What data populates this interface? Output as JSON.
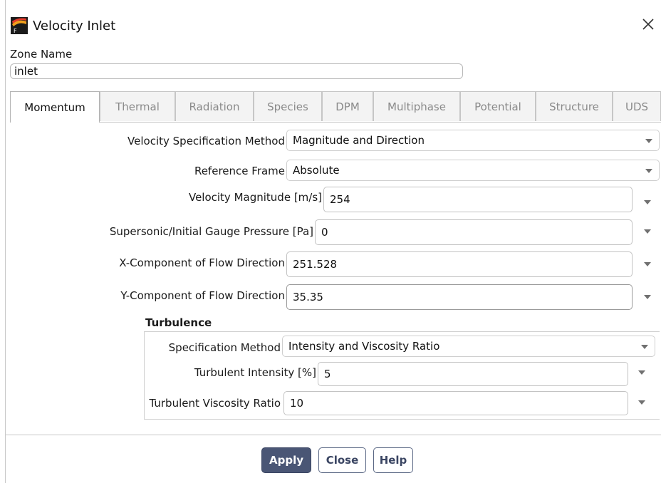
{
  "window": {
    "title": "Velocity Inlet",
    "icon": "fluent-logo-icon",
    "close_icon": "close-icon"
  },
  "zone": {
    "label": "Zone Name",
    "value": "inlet"
  },
  "tabs": [
    {
      "label": "Momentum",
      "active": true
    },
    {
      "label": "Thermal"
    },
    {
      "label": "Radiation"
    },
    {
      "label": "Species"
    },
    {
      "label": "DPM"
    },
    {
      "label": "Multiphase"
    },
    {
      "label": "Potential"
    },
    {
      "label": "Structure"
    },
    {
      "label": "UDS"
    }
  ],
  "momentum": {
    "velocity_spec": {
      "label": "Velocity Specification Method",
      "value": "Magnitude and Direction"
    },
    "reference_frame": {
      "label": "Reference Frame",
      "value": "Absolute"
    },
    "velocity_magnitude": {
      "label": "Velocity Magnitude [m/s]",
      "value": "254"
    },
    "gauge_pressure": {
      "label": "Supersonic/Initial Gauge Pressure [Pa]",
      "value": "0"
    },
    "x_component": {
      "label": "X-Component of Flow Direction",
      "value": "251.528"
    },
    "y_component": {
      "label": "Y-Component of Flow Direction",
      "value": "35.35"
    }
  },
  "turbulence": {
    "title": "Turbulence",
    "spec_method": {
      "label": "Specification Method",
      "value": "Intensity and Viscosity Ratio"
    },
    "intensity": {
      "label": "Turbulent Intensity [%]",
      "value": "5"
    },
    "viscosity_ratio": {
      "label": "Turbulent Viscosity Ratio",
      "value": "10"
    }
  },
  "buttons": {
    "apply": "Apply",
    "close": "Close",
    "help": "Help"
  },
  "colors": {
    "primary_button": "#4a5675",
    "border": "#c2c2c2"
  }
}
